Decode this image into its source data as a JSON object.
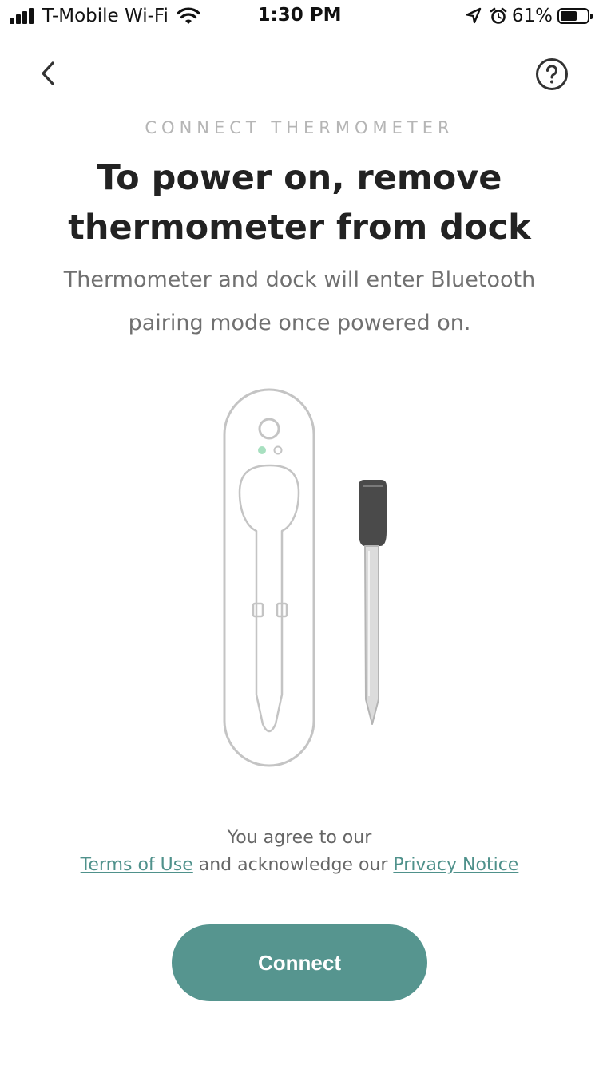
{
  "status_bar": {
    "carrier": "T-Mobile Wi-Fi",
    "time": "1:30 PM",
    "battery_percent": "61%",
    "battery_level": 0.61,
    "icons": [
      "signal-icon",
      "wifi-icon",
      "location-arrow-icon",
      "alarm-icon",
      "battery-icon"
    ]
  },
  "nav": {
    "back_icon": "chevron-left-icon",
    "help_icon": "question-circle-icon"
  },
  "content": {
    "step_label": "CONNECT THERMOMETER",
    "title": "To power on, remove thermometer from dock",
    "subtitle": "Thermometer and dock will enter Bluetooth pairing mode once powered on."
  },
  "illustration": {
    "name": "thermometer-dock-illustration",
    "led_color_active": "#a8e0c0",
    "probe_color": "#4a4a4a"
  },
  "legal": {
    "line1": "You agree to our",
    "terms_link": "Terms of Use",
    "middle_text": " and acknowledge our ",
    "privacy_link": "Privacy Notice"
  },
  "actions": {
    "connect_label": "Connect"
  },
  "colors": {
    "accent": "#56958f",
    "link": "#4f918b",
    "muted_label": "#b5b5b5",
    "body_text": "#707070"
  }
}
